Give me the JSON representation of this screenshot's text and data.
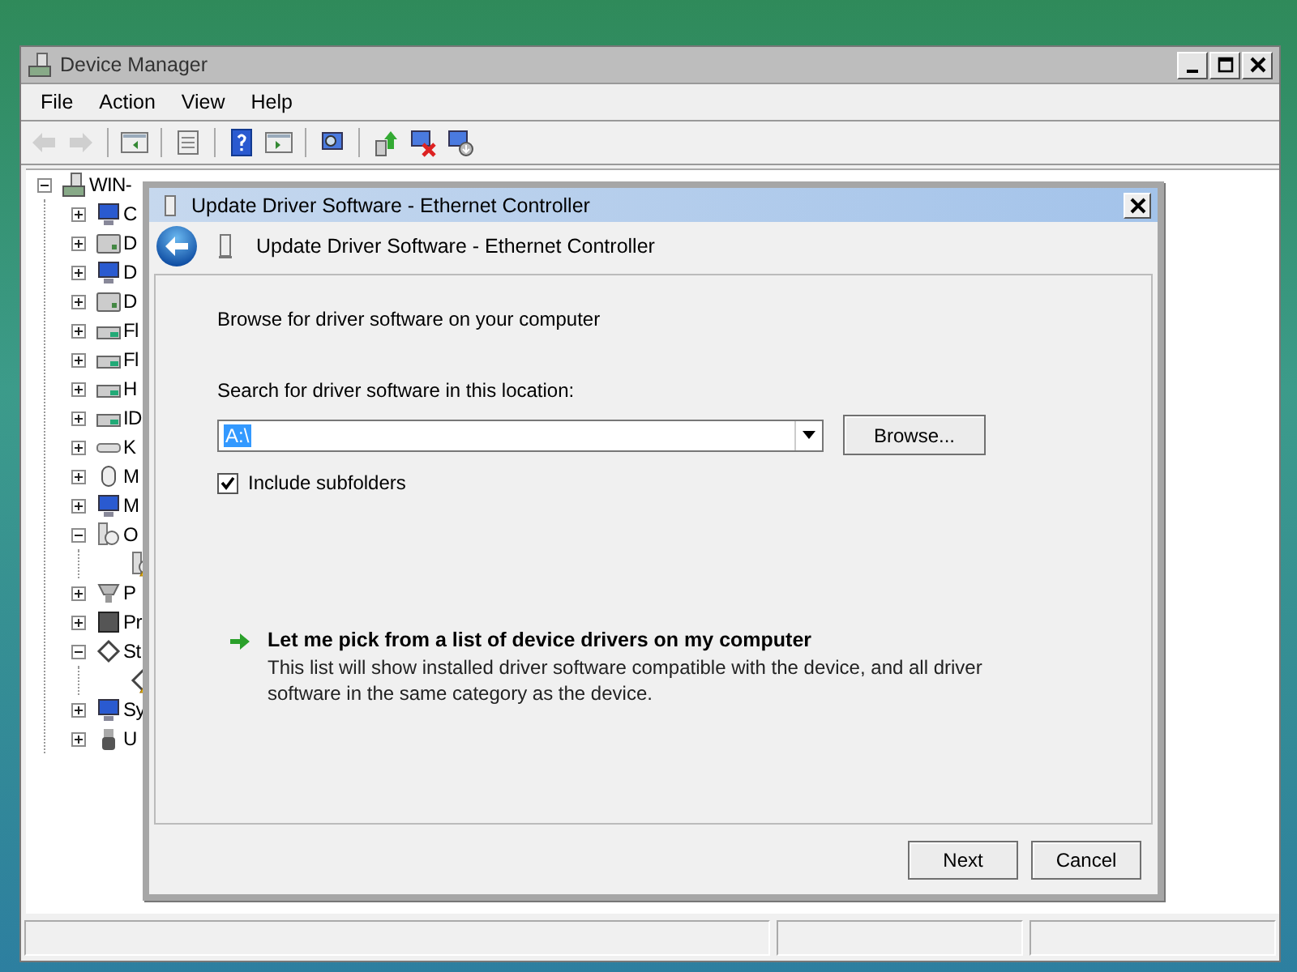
{
  "window": {
    "title": "Device Manager"
  },
  "menu": [
    "File",
    "Action",
    "View",
    "Help"
  ],
  "toolbar": [
    {
      "kind": "back",
      "disabled": true
    },
    {
      "kind": "forward",
      "disabled": true
    },
    {
      "kind": "sep"
    },
    {
      "kind": "tree-pane",
      "disabled": false
    },
    {
      "kind": "sep"
    },
    {
      "kind": "properties",
      "disabled": false
    },
    {
      "kind": "sep"
    },
    {
      "kind": "help",
      "disabled": false
    },
    {
      "kind": "action-pane",
      "disabled": false
    },
    {
      "kind": "sep"
    },
    {
      "kind": "scan",
      "disabled": false
    },
    {
      "kind": "sep"
    },
    {
      "kind": "update",
      "disabled": false
    },
    {
      "kind": "uninstall",
      "disabled": false
    },
    {
      "kind": "disable",
      "disabled": false
    }
  ],
  "device_tree": [
    {
      "label": "WIN-",
      "kind": "computer",
      "expanded": true,
      "warning": false,
      "children": [
        {
          "label": "C",
          "kind": "monitor",
          "expanded": false,
          "warning": false
        },
        {
          "label": "D",
          "kind": "drive",
          "expanded": false,
          "warning": false
        },
        {
          "label": "D",
          "kind": "monitor",
          "expanded": false,
          "warning": false
        },
        {
          "label": "D",
          "kind": "drive",
          "expanded": false,
          "warning": false
        },
        {
          "label": "Fl",
          "kind": "controller",
          "expanded": false,
          "warning": false
        },
        {
          "label": "Fl",
          "kind": "controller",
          "expanded": false,
          "warning": false
        },
        {
          "label": "H",
          "kind": "controller",
          "expanded": false,
          "warning": false
        },
        {
          "label": "ID",
          "kind": "controller",
          "expanded": false,
          "warning": false
        },
        {
          "label": "K",
          "kind": "keyboard",
          "expanded": false,
          "warning": false
        },
        {
          "label": "M",
          "kind": "mouse",
          "expanded": false,
          "warning": false
        },
        {
          "label": "M",
          "kind": "monitor",
          "expanded": false,
          "warning": false
        },
        {
          "label": "O",
          "kind": "unknown",
          "expanded": true,
          "warning": false,
          "children": [
            {
              "kind": "unknown",
              "warning": true
            }
          ]
        },
        {
          "label": "P",
          "kind": "port",
          "expanded": false,
          "warning": false
        },
        {
          "label": "Pr",
          "kind": "chip",
          "expanded": false,
          "warning": false
        },
        {
          "label": "St",
          "kind": "storage",
          "expanded": true,
          "warning": false,
          "children": [
            {
              "kind": "storage",
              "warning": true
            }
          ]
        },
        {
          "label": "Sy",
          "kind": "monitor",
          "expanded": false,
          "warning": false
        },
        {
          "label": "U",
          "kind": "usb",
          "expanded": false,
          "warning": false
        }
      ]
    }
  ],
  "dialog": {
    "title": "Update Driver Software - Ethernet Controller",
    "header_title": "Update Driver Software - Ethernet Controller",
    "heading": "Browse for driver software on your computer",
    "location_label": "Search for driver software in this location:",
    "location": {
      "value": "A:\\",
      "value_selected": true
    },
    "browse_button": "Browse...",
    "include_subfolders": {
      "label": "Include subfolders",
      "checked": true
    },
    "option": {
      "title": "Let me pick from a list of device drivers on my computer",
      "description": "This list will show installed driver software compatible with the device, and all driver software in the same category as the device."
    },
    "buttons": [
      "Next",
      "Cancel"
    ]
  }
}
